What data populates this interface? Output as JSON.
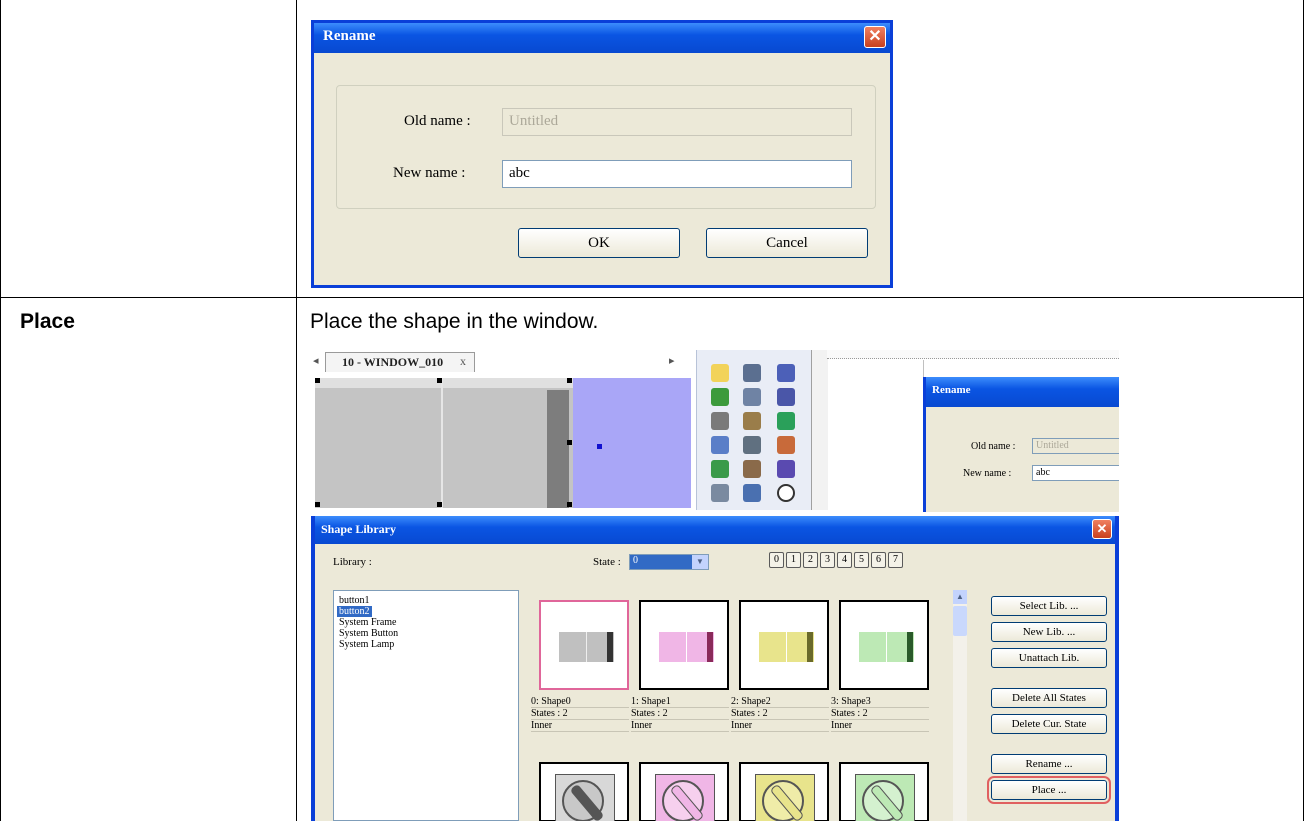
{
  "rename_dialog": {
    "title": "Rename",
    "old_name_label": "Old name :",
    "old_name_value": "Untitled",
    "new_name_label": "New name :",
    "new_name_value": "abc",
    "ok_label": "OK",
    "cancel_label": "Cancel"
  },
  "table_row": {
    "label": "Place",
    "description": "Place the shape in the window."
  },
  "workspace": {
    "tab_label": "10 - WINDOW_010",
    "tab_close": "x"
  },
  "mini_rename": {
    "title": "Rename",
    "old_name_label": "Old name :",
    "old_name_value": "Untitled",
    "new_name_label": "New name :",
    "new_name_value": "abc"
  },
  "shape_library": {
    "title": "Shape Library",
    "library_label": "Library :",
    "state_label": "State :",
    "state_value": "0",
    "state_buttons": [
      "0",
      "1",
      "2",
      "3",
      "4",
      "5",
      "6",
      "7"
    ],
    "libraries": [
      "button1",
      "button2",
      "System Frame",
      "System Button",
      "System Lamp"
    ],
    "shapes": [
      {
        "name": "0: Shape0",
        "states": "States : 2",
        "type": "Inner"
      },
      {
        "name": "1: Shape1",
        "states": "States : 2",
        "type": "Inner"
      },
      {
        "name": "2: Shape2",
        "states": "States : 2",
        "type": "Inner"
      },
      {
        "name": "3: Shape3",
        "states": "States : 2",
        "type": "Inner"
      }
    ],
    "buttons": {
      "select_lib": "Select Lib. ...",
      "new_lib": "New Lib. ...",
      "unattach_lib": "Unattach Lib.",
      "delete_all_states": "Delete All States",
      "delete_cur_state": "Delete Cur. State",
      "rename": "Rename ...",
      "place": "Place ..."
    },
    "colors": {
      "shape0": "#c0c0c0",
      "shape1": "#f0b6e6",
      "shape2": "#e8e48c",
      "shape3": "#bde9b5"
    }
  }
}
